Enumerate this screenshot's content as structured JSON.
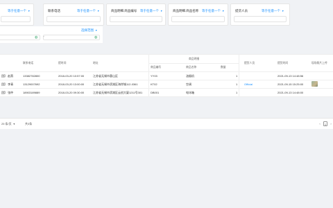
{
  "filters": [
    {
      "label": "",
      "select": "等于任意一个"
    },
    {
      "label": "联系电话",
      "select": "等于任意一个"
    },
    {
      "label": "商品明细.商品编号",
      "select": "等于任意一个"
    },
    {
      "label": "商品明细.商品名称",
      "select": "等于任意一个"
    },
    {
      "label": "提货人员",
      "select": "等于任意一个"
    }
  ],
  "row2": {
    "select": "选择范围"
  },
  "table": {
    "headers": {
      "customer": "",
      "phone": "联系电话",
      "submit_time": "提时间",
      "address": "地址",
      "detail_group": "商品明细",
      "product_code": "商品编号",
      "product_name": "商品名称",
      "qty": "数量",
      "picker": "提货人员",
      "pickup_time": "提货时间",
      "photo": "现场照片上传"
    },
    "rows": [
      {
        "customer": "团】 赵燕",
        "phone": "13382782800",
        "submit_time": "2018-03-20 10:57:00",
        "address": "江苏省无锡市惠山区",
        "product_code": "YY03",
        "product_name": "油烟机",
        "qty": "1",
        "picker": "",
        "pickup_time": "2021-09-13 14:48:56",
        "has_photo": false
      },
      {
        "customer": "团】 李青",
        "phone": "13129007692",
        "submit_time": "2018-03-20 13:00:00",
        "address": "江苏省无锡市滨湖区海岸城112-0361",
        "product_code": "KT02",
        "product_name": "空调",
        "qty": "1",
        "picker": "Official",
        "pickup_time": "2021-09-15 15:25:00",
        "has_photo": true
      },
      {
        "customer": "团】 张仲",
        "phone": "18903189889",
        "submit_time": "2018-03-20 09:30:00",
        "address": "江苏省无锡市滨湖区云创大厦1211号301",
        "product_code": "DB001",
        "product_name": "电冰箱",
        "qty": "1",
        "picker": "",
        "pickup_time": "2021-09-13 14:48:00",
        "has_photo": false
      }
    ]
  },
  "footer": {
    "page_size": "25 条/页",
    "total": "共3条",
    "page": "1"
  },
  "colors": {
    "accent": "#1890ff",
    "green": "#3aa76d"
  }
}
